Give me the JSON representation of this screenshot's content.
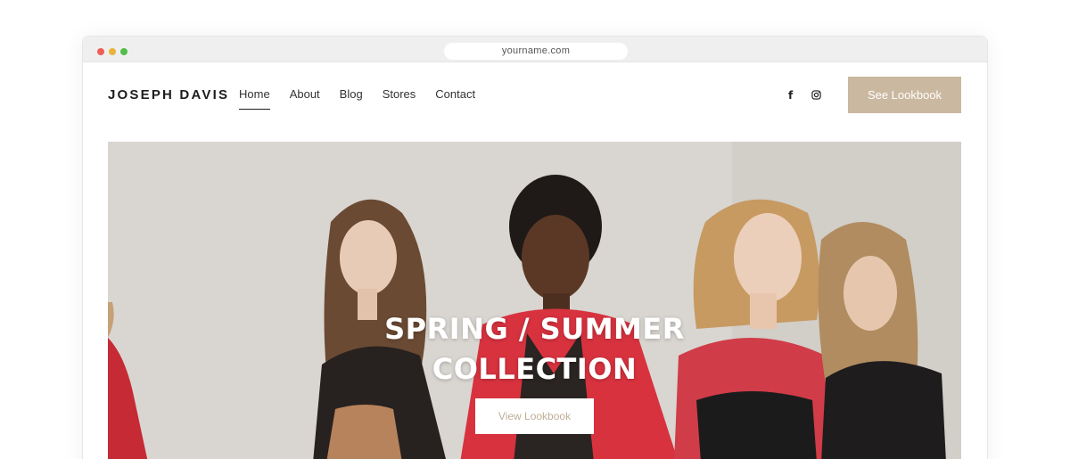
{
  "browser": {
    "url": "yourname.com"
  },
  "header": {
    "brand": "JOSEPH DAVIS",
    "nav": [
      {
        "label": "Home",
        "active": true
      },
      {
        "label": "About",
        "active": false
      },
      {
        "label": "Blog",
        "active": false
      },
      {
        "label": "Stores",
        "active": false
      },
      {
        "label": "Contact",
        "active": false
      }
    ],
    "social_icons": [
      "facebook-icon",
      "instagram-icon"
    ],
    "cta_label": "See Lookbook"
  },
  "hero": {
    "title_line1": "SPRING / SUMMER",
    "title_line2": "COLLECTION",
    "button_label": "View Lookbook"
  },
  "colors": {
    "accent": "#cbb8a0",
    "hero_button_text": "#bfae98",
    "text_dark": "#1d1d1d"
  }
}
